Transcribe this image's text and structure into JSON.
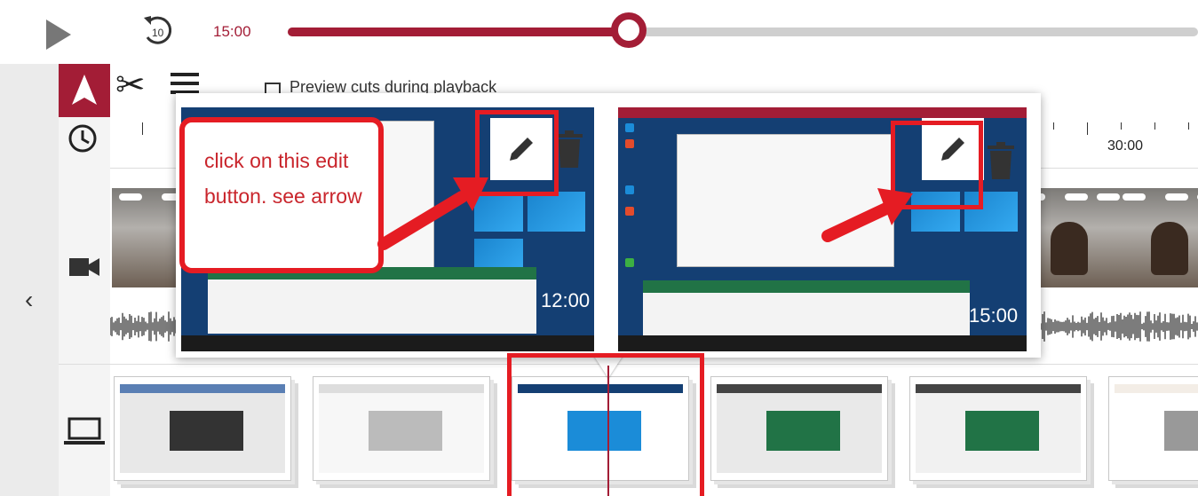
{
  "player": {
    "current_time": "15:00",
    "progress_fraction": 0.375,
    "rewind_label": "10",
    "accent": "#a31d36"
  },
  "tools": {
    "preview_label": "Preview cuts during playback",
    "icons": [
      "pointer-icon",
      "scissors-icon",
      "list-icon",
      "clock-icon",
      "camera-icon",
      "laptop-icon"
    ]
  },
  "ruler": {
    "label": "30:00"
  },
  "popup": {
    "clips": [
      {
        "time": "12:00",
        "actions": [
          "pencil-icon",
          "trash-icon"
        ]
      },
      {
        "time": "15:00",
        "actions": [
          "pencil-icon",
          "trash-icon"
        ]
      }
    ]
  },
  "annotation": {
    "callout_text": "click on this edit button. see arrow",
    "color": "#e51c23"
  },
  "sidebar": {
    "collapse_icon": "chevron-left-icon"
  }
}
